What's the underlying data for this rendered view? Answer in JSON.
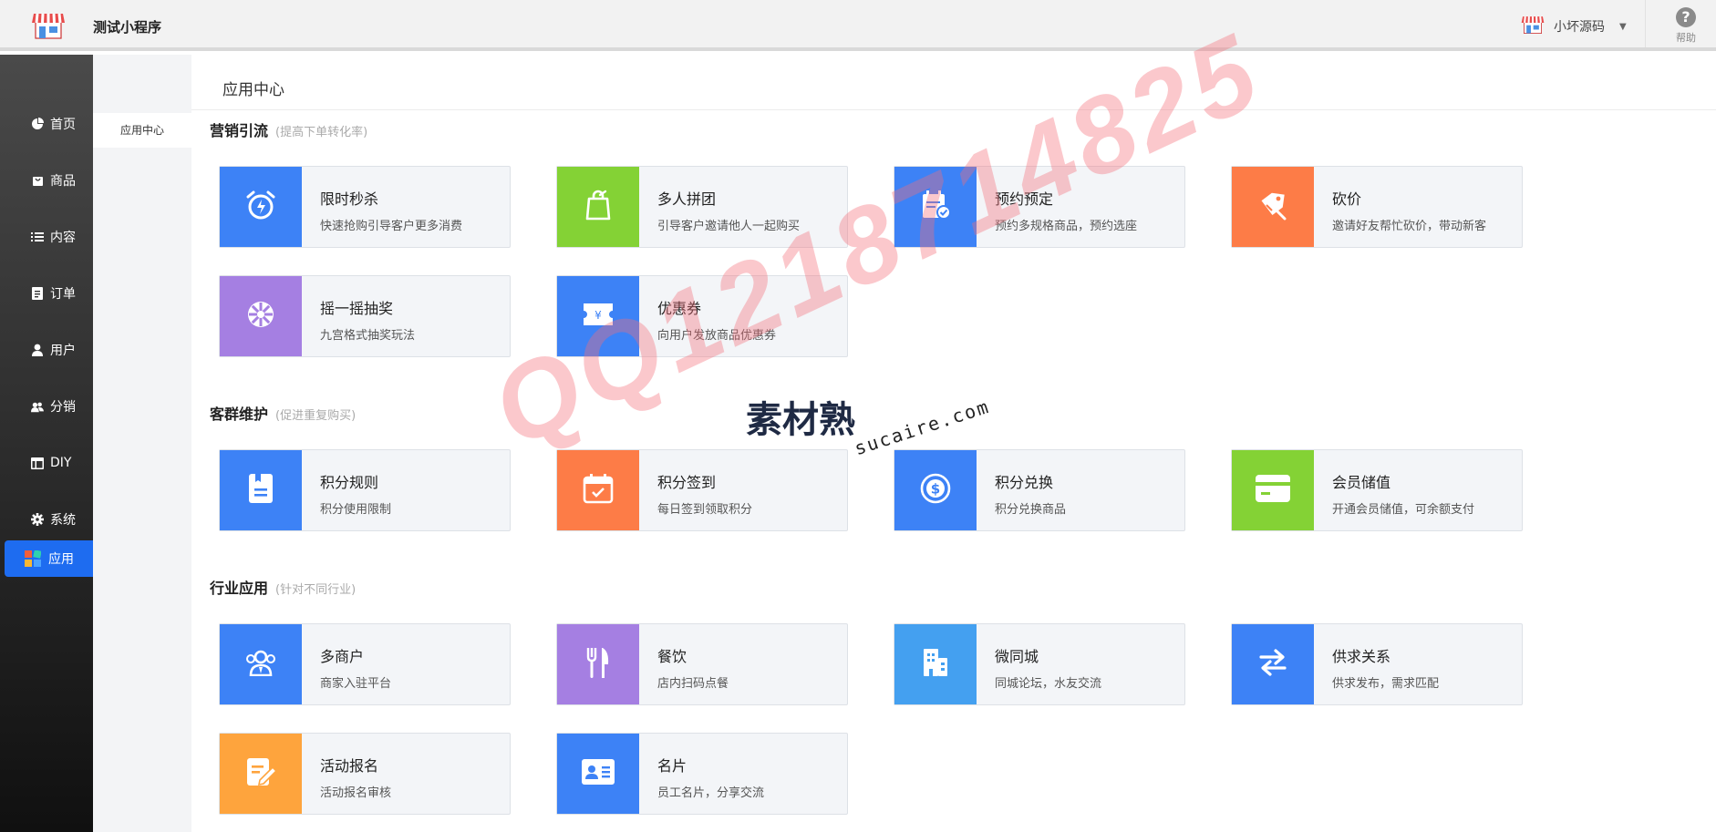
{
  "header": {
    "app_name": "测试小程序",
    "user_name": "小坏源码",
    "help_label": "帮助"
  },
  "nav": {
    "items": [
      {
        "label": "首页",
        "icon": "pie-chart-icon"
      },
      {
        "label": "商品",
        "icon": "shopping-bag-icon"
      },
      {
        "label": "内容",
        "icon": "list-icon"
      },
      {
        "label": "订单",
        "icon": "document-icon"
      },
      {
        "label": "用户",
        "icon": "user-icon"
      },
      {
        "label": "分销",
        "icon": "users-icon"
      },
      {
        "label": "DIY",
        "icon": "layout-icon"
      },
      {
        "label": "系统",
        "icon": "gear-icon"
      },
      {
        "label": "应用",
        "icon": "apps-icon",
        "active": true
      }
    ],
    "active_color": "#1e6cf0"
  },
  "subnav": {
    "items": [
      {
        "label": "应用中心"
      }
    ]
  },
  "main": {
    "title": "应用中心"
  },
  "sections": [
    {
      "title": "营销引流",
      "hint": "(提高下单转化率)"
    },
    {
      "title": "客群维护",
      "hint": "(促进重复购买)"
    },
    {
      "title": "行业应用",
      "hint": "(针对不同行业)"
    }
  ],
  "cards": [
    {
      "name": "限时秒杀",
      "desc": "快速抢购引导客户更多消费",
      "color": "#3d82f6",
      "icon": "alarm-clock-icon"
    },
    {
      "name": "多人拼团",
      "desc": "引导客户邀请他人一起购买",
      "color": "#84d235",
      "icon": "shopping-bag-icon"
    },
    {
      "name": "预约预定",
      "desc": "预约多规格商品，预约选座",
      "color": "#3d82f6",
      "icon": "calendar-check-icon"
    },
    {
      "name": "砍价",
      "desc": "邀请好友帮忙砍价，带动新客",
      "color": "#fd7c47",
      "icon": "price-tag-icon"
    },
    {
      "name": "摇一摇抽奖",
      "desc": "九宫格式抽奖玩法",
      "color": "#a57fe2",
      "icon": "prize-wheel-icon"
    },
    {
      "name": "优惠券",
      "desc": "向用户发放商品优惠券",
      "color": "#3d82f6",
      "icon": "coupon-icon"
    },
    {
      "name": "积分规则",
      "desc": "积分使用限制",
      "color": "#3d82f6",
      "icon": "rules-document-icon"
    },
    {
      "name": "积分签到",
      "desc": "每日签到领取积分",
      "color": "#fd7c47",
      "icon": "calendar-sign-icon"
    },
    {
      "name": "积分兑换",
      "desc": "积分兑换商品",
      "color": "#3d82f6",
      "icon": "dollar-coin-icon"
    },
    {
      "name": "会员储值",
      "desc": "开通会员储值，可余额支付",
      "color": "#84d235",
      "icon": "card-icon"
    },
    {
      "name": "多商户",
      "desc": "商家入驻平台",
      "color": "#3d82f6",
      "icon": "merchants-icon"
    },
    {
      "name": "餐饮",
      "desc": "店内扫码点餐",
      "color": "#a57fe2",
      "icon": "fork-knife-icon"
    },
    {
      "name": "微同城",
      "desc": "同城论坛，水友交流",
      "color": "#44a0f0",
      "icon": "building-icon"
    },
    {
      "name": "供求关系",
      "desc": "供求发布，需求匹配",
      "color": "#3d82f6",
      "icon": "swap-arrows-icon"
    },
    {
      "name": "活动报名",
      "desc": "活动报名审核",
      "color": "#fea43d",
      "icon": "edit-form-icon"
    },
    {
      "name": "名片",
      "desc": "员工名片，分享交流",
      "color": "#3d82f6",
      "icon": "id-card-icon"
    }
  ],
  "watermark": {
    "qq_text": "QQ1218714825",
    "logo_cn": "素材熟",
    "logo_en": "sucaire.com"
  }
}
